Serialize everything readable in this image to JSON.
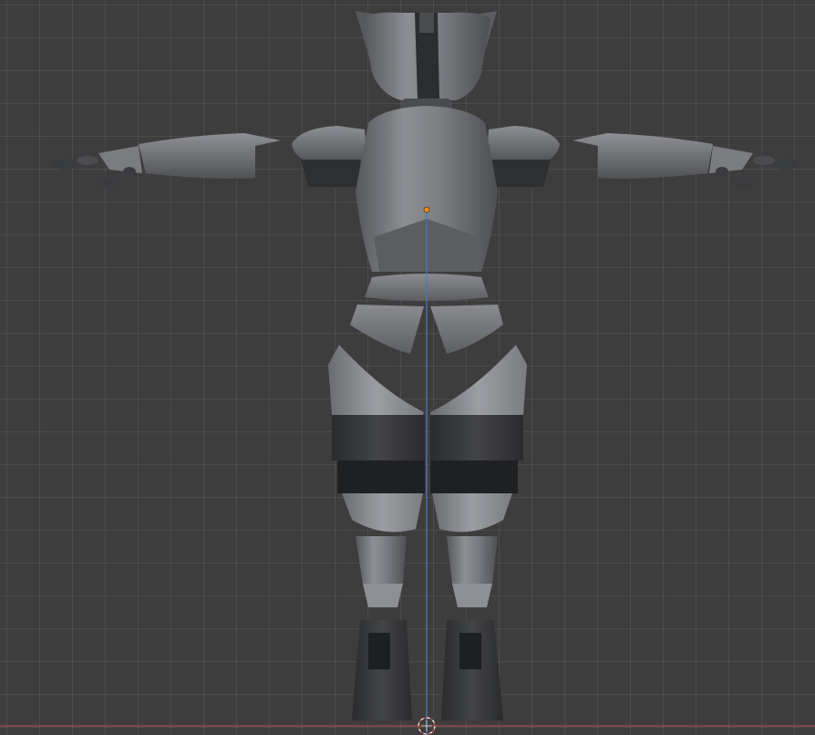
{
  "viewport": {
    "background_color": "#3d3d3d",
    "grid_color": "#4a4a4a",
    "z_axis_color": "#4a77c9",
    "x_axis_color": "#c24a4a",
    "origin_marker_color": "#ff8a1f",
    "cursor_color": "#c24a4a",
    "mesh_light": "#8e9095",
    "mesh_mid": "#6c6e72",
    "mesh_dark": "#37383b",
    "mesh_shadow": "#232426",
    "icons": [
      "3d-cursor-icon",
      "object-origin-icon"
    ]
  }
}
